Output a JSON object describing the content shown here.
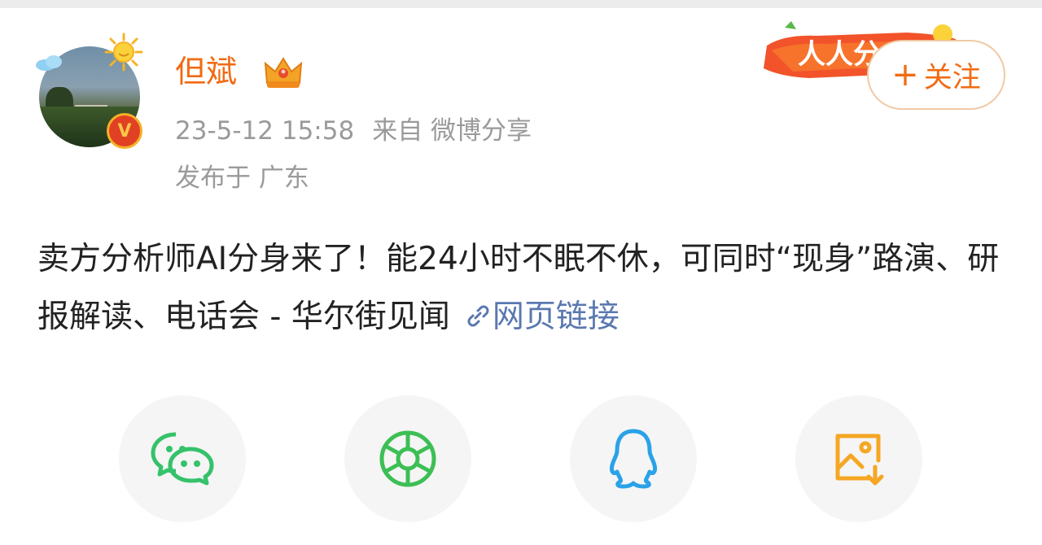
{
  "user": {
    "name": "但斌",
    "verified_badge": "V",
    "follow_label": "+关注",
    "follow_plus": "+",
    "follow_text": "关注"
  },
  "meta": {
    "date": "23-5-12",
    "time": "15:58",
    "source": "来自 微博分享",
    "location": "发布于 广东"
  },
  "banner": {
    "text": "人人分"
  },
  "post": {
    "text": "卖方分析师AI分身来了！能24小时不眠不休，可同时“现身”路演、研报解读、电话会 - 华尔街见闻",
    "link_label": "网页链接",
    "link_color": "#5a78b0"
  },
  "share": {
    "buttons": [
      "wechat-icon",
      "moments-icon",
      "qq-icon",
      "save-image-icon"
    ],
    "colors": {
      "wechat": "#35c26a",
      "moments": "#3cbf55",
      "qq": "#2aa2e8",
      "save": "#f5a623"
    }
  },
  "colors": {
    "username": "#f06b13",
    "meta": "#9a9a9a",
    "body": "#222222"
  }
}
